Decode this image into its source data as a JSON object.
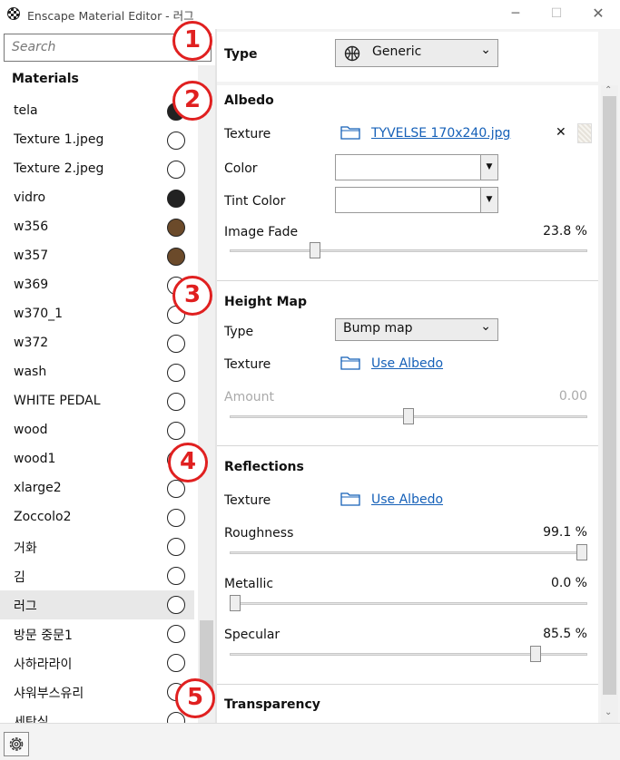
{
  "window": {
    "title": "Enscape Material Editor - 러그",
    "minimize": "─",
    "maximize": "☐",
    "close": "✕"
  },
  "search": {
    "placeholder": "Search"
  },
  "materials": {
    "header": "Materials",
    "items": [
      {
        "name": "tela",
        "color": "#222222"
      },
      {
        "name": "Texture 1.jpeg",
        "color": "#ffffff"
      },
      {
        "name": "Texture 2.jpeg",
        "color": "#ffffff"
      },
      {
        "name": "vidro",
        "color": "#222222"
      },
      {
        "name": "w356",
        "color": "#6b4a2a"
      },
      {
        "name": "w357",
        "color": "#6b4a2a"
      },
      {
        "name": "w369",
        "color": "#ffffff"
      },
      {
        "name": "w370_1",
        "color": "#ffffff"
      },
      {
        "name": "w372",
        "color": "#ffffff"
      },
      {
        "name": "wash",
        "color": "#ffffff"
      },
      {
        "name": "WHITE PEDAL",
        "color": "#ffffff"
      },
      {
        "name": "wood",
        "color": "#ffffff"
      },
      {
        "name": "wood1",
        "color": "#ffffff"
      },
      {
        "name": "xlarge2",
        "color": "#ffffff"
      },
      {
        "name": "Zoccolo2",
        "color": "#ffffff"
      },
      {
        "name": "거화",
        "color": "#ffffff"
      },
      {
        "name": "김",
        "color": "#ffffff"
      },
      {
        "name": "러그",
        "color": "#ffffff",
        "selected": true
      },
      {
        "name": "방문 중문1",
        "color": "#ffffff"
      },
      {
        "name": "사하라라이",
        "color": "#ffffff"
      },
      {
        "name": "샤워부스유리",
        "color": "#ffffff"
      },
      {
        "name": "세탁실",
        "color": "#ffffff"
      }
    ]
  },
  "type_panel": {
    "label": "Type",
    "value": "Generic",
    "icon": "globe-icon"
  },
  "albedo": {
    "header": "Albedo",
    "texture_label": "Texture",
    "texture_value": "TYVELSE 170x240.jpg",
    "clear": "✕",
    "color_label": "Color",
    "color_value": "",
    "tint_label": "Tint Color",
    "tint_value": "",
    "fade_label": "Image Fade",
    "fade_value": "23.8  %",
    "fade_fraction": 0.238
  },
  "height_map": {
    "header": "Height Map",
    "type_label": "Type",
    "type_value": "Bump map",
    "texture_label": "Texture",
    "texture_value": "Use Albedo",
    "amount_label": "Amount",
    "amount_value": "0.00",
    "amount_fraction": 0.5
  },
  "reflections": {
    "header": "Reflections",
    "texture_label": "Texture",
    "texture_value": "Use Albedo",
    "roughness_label": "Roughness",
    "roughness_value": "99.1  %",
    "roughness_fraction": 0.991,
    "metallic_label": "Metallic",
    "metallic_value": "0.0  %",
    "metallic_fraction": 0.0,
    "specular_label": "Specular",
    "specular_value": "85.5  %",
    "specular_fraction": 0.855
  },
  "transparency": {
    "header": "Transparency"
  },
  "annotations": [
    "1",
    "2",
    "3",
    "4",
    "5"
  ],
  "accent_color": "#1560b8",
  "annotation_color": "#e02020"
}
